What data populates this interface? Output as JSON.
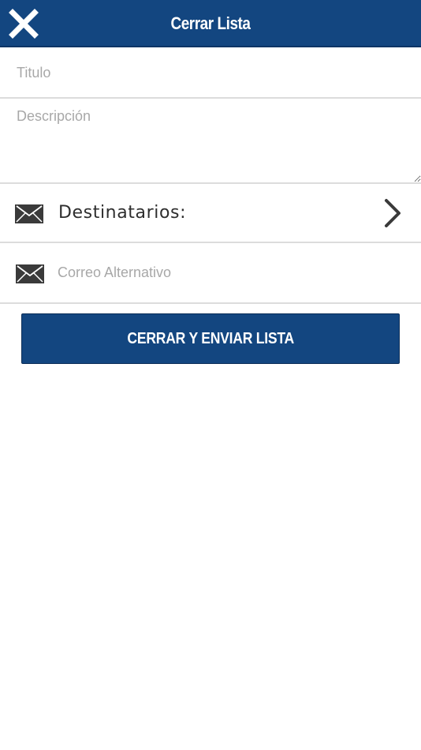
{
  "header": {
    "title": "Cerrar Lista",
    "close_icon": "close-icon",
    "background_color": "#134680"
  },
  "form": {
    "title_placeholder": "Titulo",
    "title_value": "",
    "description_placeholder": "Descripción",
    "description_value": "",
    "recipients_label": "Destinatarios:",
    "recipients_icon": "envelope-icon",
    "recipients_chevron": "chevron-right-icon",
    "alt_email_placeholder": "Correo Alternativo",
    "alt_email_value": "",
    "alt_email_icon": "envelope-icon"
  },
  "actions": {
    "submit_label": "CERRAR Y ENVIAR LISTA",
    "accent_color": "#134680"
  }
}
